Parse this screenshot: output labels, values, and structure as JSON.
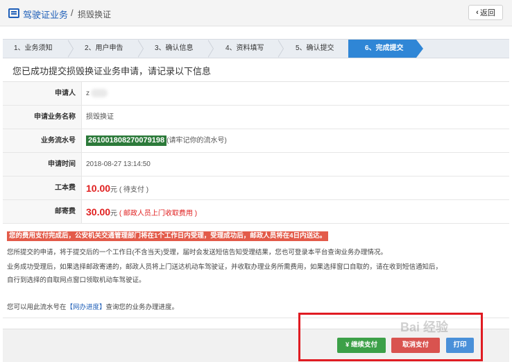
{
  "header": {
    "title": "驾驶证业务",
    "separator": "/",
    "crumb": "损毁换证",
    "back_label": "返回"
  },
  "steps": [
    {
      "label": "1、业务须知"
    },
    {
      "label": "2、用户申告"
    },
    {
      "label": "3、确认信息"
    },
    {
      "label": "4、资料填写"
    },
    {
      "label": "5、确认提交"
    },
    {
      "label": "6、完成提交"
    }
  ],
  "heading": "您已成功提交损毁换证业务申请，请记录以下信息",
  "info": {
    "applicant_label": "申请人",
    "applicant_value": "z",
    "business_label": "申请业务名称",
    "business_value": "损毁换证",
    "serial_label": "业务流水号",
    "serial_value": "261001808270079198",
    "serial_note": "(请牢记你的流水号)",
    "time_label": "申请时间",
    "time_value": "2018-08-27 13:14:50",
    "cost_label": "工本费",
    "cost_value": "10.00",
    "cost_unit": "元",
    "cost_note": "( 待支付 )",
    "post_label": "邮寄费",
    "post_value": "30.00",
    "post_unit": "元",
    "post_note": "( 邮政人员上门收取费用 )"
  },
  "notice": {
    "alert": "您的费用支付完成后，公安机关交通管理部门将在1个工作日内受理，受理成功后，邮政人员将在4日内送达。",
    "para1": "您所提交的申请，将于提交后的一个工作日(不含当天)受理，届时会发送短信告知受理结果，您也可登录本平台查询业务办理情况。",
    "para2": "业务成功受理后，如果选择邮政寄递的，邮政人员将上门送达机动车驾驶证，并收取办理业务所需费用，如果选择窗口自取的，请在收到短信通知后，",
    "para3": "自行到选择的自取网点窗口领取机动车驾驶证。",
    "para4_prefix": "您可以用此流水号在",
    "para4_link": "【网办进度】",
    "para4_suffix": "查询您的业务办理进度。"
  },
  "buttons": {
    "pay": "¥ 继续支付",
    "cancel": "取消支付",
    "print": "打印"
  },
  "colors": {
    "brand_blue": "#1f5fb8",
    "active_step": "#2f86d6",
    "serial_bg": "#2c7a3a",
    "fee_red": "#e02020",
    "pay_green": "#3ca048",
    "cancel_red": "#d9534f",
    "highlight_red": "#e01b22"
  },
  "icons": {
    "header": "document-icon",
    "back": "chevron-left-icon"
  },
  "watermark": "Bai 经验"
}
